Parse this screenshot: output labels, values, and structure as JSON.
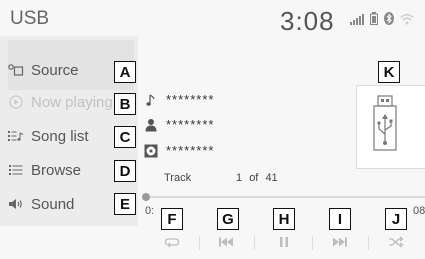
{
  "header": {
    "title": "USB",
    "time": "3:08",
    "icons": [
      "signal-bars-icon",
      "battery-icon",
      "bluetooth-icon",
      "wifi-icon"
    ]
  },
  "sidebar": {
    "items": [
      {
        "label": "Source",
        "icon": "source-icon",
        "state": "normal"
      },
      {
        "label": "Now playing",
        "icon": "play-circle-icon",
        "state": "selected"
      },
      {
        "label": "Song list",
        "icon": "song-list-icon",
        "state": "normal"
      },
      {
        "label": "Browse",
        "icon": "browse-icon",
        "state": "normal"
      },
      {
        "label": "Sound",
        "icon": "speaker-icon",
        "state": "normal"
      }
    ]
  },
  "track": {
    "title": "********",
    "artist": "********",
    "album": "********",
    "track_label": "Track",
    "track_number": "1",
    "of_label": "of",
    "track_total": "41"
  },
  "progress": {
    "elapsed": "0:",
    "total": "08",
    "fraction": 0.0
  },
  "controls": [
    "repeat",
    "previous",
    "pause",
    "next",
    "shuffle"
  ],
  "callouts": [
    "A",
    "B",
    "C",
    "D",
    "E",
    "F",
    "G",
    "H",
    "I",
    "J",
    "K"
  ],
  "colors": {
    "background": "#f7f7f7",
    "text": "#333333",
    "dim": "#c2c2c2",
    "control": "#bdbdbd"
  }
}
